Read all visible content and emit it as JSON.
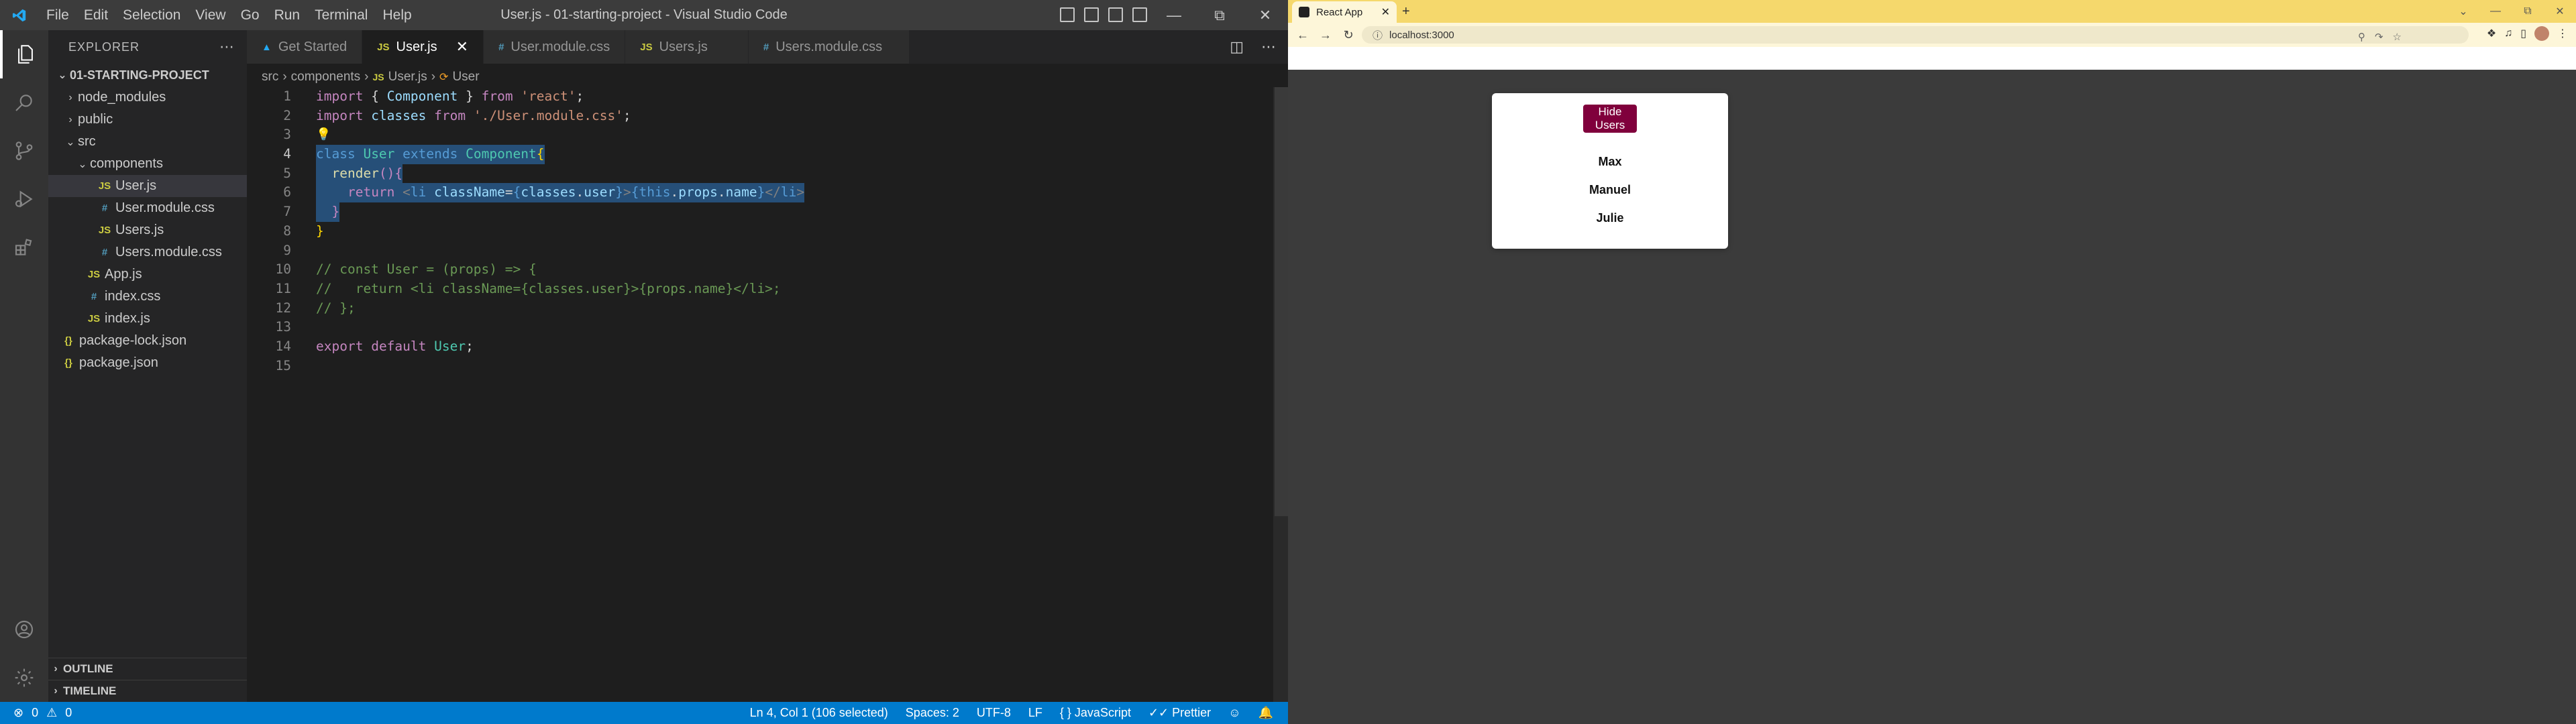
{
  "vscode": {
    "window_title": "User.js - 01-starting-project - Visual Studio Code",
    "menu": [
      "File",
      "Edit",
      "Selection",
      "View",
      "Go",
      "Run",
      "Terminal",
      "Help"
    ],
    "explorer": {
      "header": "EXPLORER",
      "project": "01-STARTING-PROJECT",
      "tree": [
        {
          "label": "node_modules",
          "type": "folder",
          "depth": 1,
          "open": false
        },
        {
          "label": "public",
          "type": "folder",
          "depth": 1,
          "open": false
        },
        {
          "label": "src",
          "type": "folder",
          "depth": 1,
          "open": true
        },
        {
          "label": "components",
          "type": "folder",
          "depth": 2,
          "open": true
        },
        {
          "label": "User.js",
          "type": "js",
          "depth": 3,
          "selected": true
        },
        {
          "label": "User.module.css",
          "type": "css",
          "depth": 3
        },
        {
          "label": "Users.js",
          "type": "js",
          "depth": 3
        },
        {
          "label": "Users.module.css",
          "type": "css",
          "depth": 3
        },
        {
          "label": "App.js",
          "type": "js",
          "depth": 2
        },
        {
          "label": "index.css",
          "type": "css",
          "depth": 2
        },
        {
          "label": "index.js",
          "type": "js",
          "depth": 2
        },
        {
          "label": "package-lock.json",
          "type": "json",
          "depth": 1
        },
        {
          "label": "package.json",
          "type": "json",
          "depth": 1
        }
      ],
      "outline_label": "OUTLINE",
      "timeline_label": "TIMELINE"
    },
    "tabs": [
      {
        "label": "Get Started",
        "icon": "vscode-icon",
        "active": false
      },
      {
        "label": "User.js",
        "icon": "JS",
        "active": true
      },
      {
        "label": "User.module.css",
        "icon": "#",
        "active": false
      },
      {
        "label": "Users.js",
        "icon": "JS",
        "active": false
      },
      {
        "label": "Users.module.css",
        "icon": "#",
        "active": false
      }
    ],
    "breadcrumb": [
      "src",
      "components",
      "User.js",
      "User"
    ],
    "status": {
      "errors": "0",
      "warnings": "0",
      "position": "Ln 4, Col 1 (106 selected)",
      "spaces": "Spaces: 2",
      "encoding": "UTF-8",
      "eol": "LF",
      "language": "JavaScript",
      "formatter": "Prettier"
    }
  },
  "browser": {
    "tab_title": "React App",
    "url": "localhost:3000",
    "hide_button": "Hide Users",
    "users": [
      "Max",
      "Manuel",
      "Julie"
    ]
  }
}
